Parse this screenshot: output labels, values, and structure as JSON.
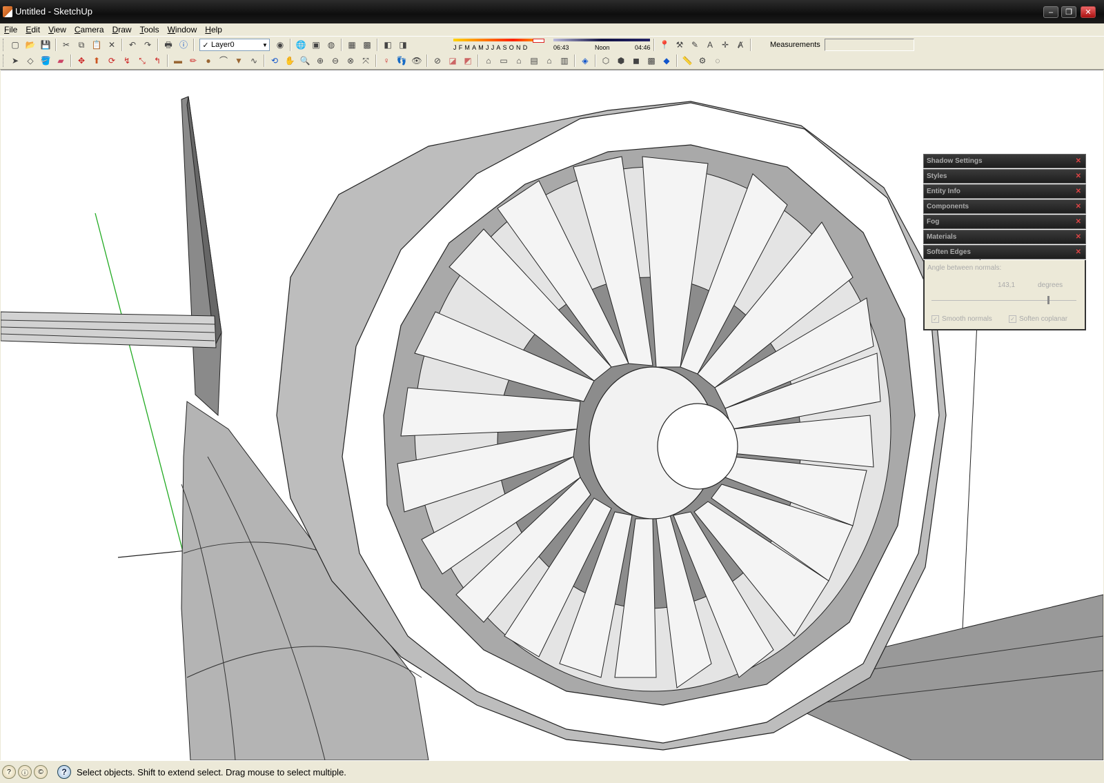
{
  "window": {
    "title": "Untitled - SketchUp",
    "buttons": {
      "minimize": "–",
      "restore": "❐",
      "close": "✕"
    }
  },
  "menu": [
    "File",
    "Edit",
    "View",
    "Camera",
    "Draw",
    "Tools",
    "Window",
    "Help"
  ],
  "toolbar": {
    "layer_checked": "✓",
    "layer_value": "Layer0",
    "shadow": {
      "months": "JFMAMJJASOND",
      "time_start": "06:43",
      "time_mid": "Noon",
      "time_end": "04:46"
    },
    "measurements_label": "Measurements",
    "measurements_value": ""
  },
  "tray": {
    "tabs": [
      "Shadow Settings",
      "Styles",
      "Entity Info",
      "Components",
      "Fog",
      "Materials",
      "Soften Edges"
    ],
    "soften": {
      "label": "Angle between normals:",
      "value": "143,1",
      "unit": "degrees",
      "slider_fraction": 0.8,
      "smooth_normals": "Smooth normals",
      "soften_coplanar": "Soften coplanar"
    }
  },
  "status": {
    "text": "Select objects. Shift to extend select. Drag mouse to select multiple.",
    "help": "?"
  },
  "colors": {
    "green_axis": "#22aa22",
    "viewport_bg": "#ffffff",
    "model_gray": "#a0a0a0"
  }
}
